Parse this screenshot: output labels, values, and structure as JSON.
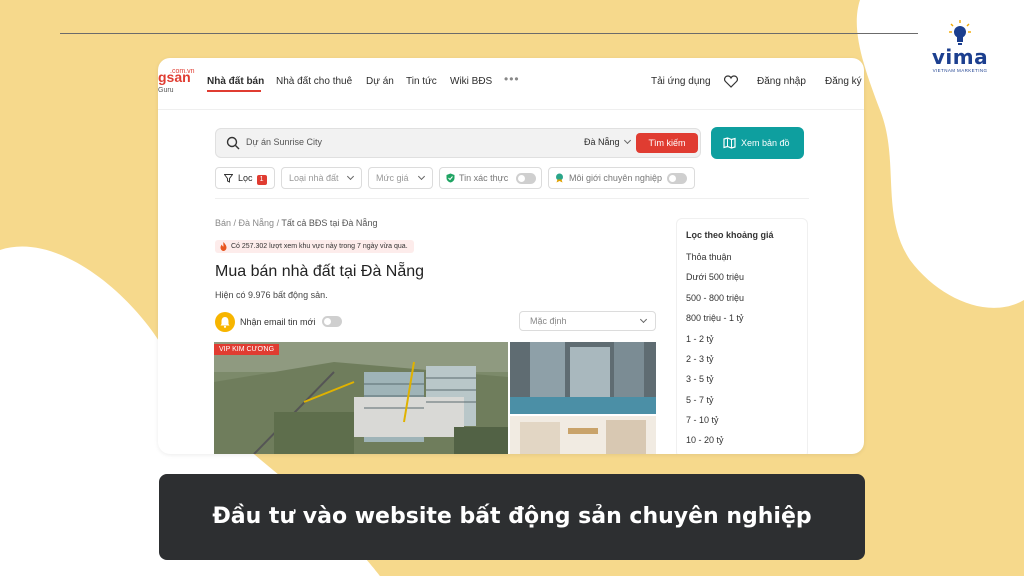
{
  "logo": {
    "word": "vima",
    "tagline": "VIETNAM MARKETING"
  },
  "site": {
    "brand": "gsan",
    "brand_suffix": ".com.vn",
    "brand_sub": "Guru"
  },
  "nav": {
    "items": [
      "Nhà đất bán",
      "Nhà đất cho thuê",
      "Dự án",
      "Tin tức",
      "Wiki BĐS"
    ],
    "more": "•••",
    "app": "Tải ứng dụng",
    "login": "Đăng nhập",
    "register": "Đăng ký"
  },
  "search": {
    "value": "Dự án Sunrise City",
    "city": "Đà Nẵng",
    "button": "Tìm kiếm",
    "map_button": "Xem bản đồ"
  },
  "filters": {
    "filter_label": "Lọc",
    "filter_count": "1",
    "property_type": "Loại nhà đất",
    "price": "Mức giá",
    "verified": "Tin xác thực",
    "pro_broker": "Môi giới chuyên nghiệp"
  },
  "breadcrumb": {
    "part1": "Bán",
    "part2": "Đà Nẵng",
    "part3": "Tất cả BĐS tại Đà Nẵng"
  },
  "views_notice": "Có 257.302 lượt xem khu vực này trong 7 ngày vừa qua.",
  "page_title": "Mua bán nhà đất tại Đà Nẵng",
  "result_count": "Hiện có 9.976 bất động sản.",
  "email_alert": "Nhận email tin mới",
  "sort": "Mặc định",
  "listing": {
    "tag": "VIP KIM CƯƠNG"
  },
  "price_filter": {
    "title": "Lọc theo khoảng giá",
    "items": [
      "Thỏa thuận",
      "Dưới 500 triệu",
      "500 - 800 triệu",
      "800 triệu - 1 tỷ",
      "1 - 2 tỷ",
      "2 - 3 tỷ",
      "3 - 5 tỷ",
      "5 - 7 tỷ",
      "7 - 10 tỷ",
      "10 - 20 tỷ"
    ]
  },
  "caption": "Đầu tư vào website bất động sản chuyên nghiệp",
  "colors": {
    "background": "#f6d98c",
    "brand_red": "#e03c31",
    "map_teal": "#0e9f9f",
    "caption_bg": "#2d2f31"
  }
}
